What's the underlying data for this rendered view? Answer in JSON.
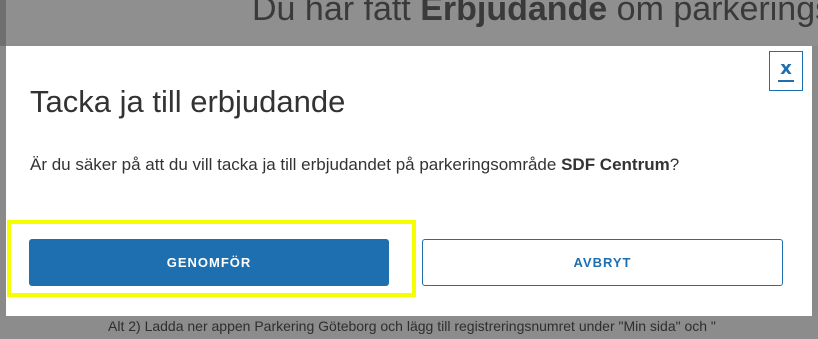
{
  "background": {
    "heading_pre": "Du har fått ",
    "heading_bold": "Erbjudande",
    "heading_post": " om parkerings",
    "bottom_text": "Alt 2) Ladda ner appen Parkering Göteborg och lägg till registreringsnumret under \"Min sida\" och \""
  },
  "dialog": {
    "close_label": "x",
    "title": "Tacka ja till erbjudande",
    "question_pre": "Är du säker på att du vill tacka ja till erbjudandet på parkeringsområde ",
    "area_name": "SDF Centrum",
    "question_post": "?",
    "confirm_label": "GENOMFÖR",
    "cancel_label": "AVBRYT"
  },
  "colors": {
    "accent": "#1e6fb0",
    "highlight": "#f5ff00"
  }
}
